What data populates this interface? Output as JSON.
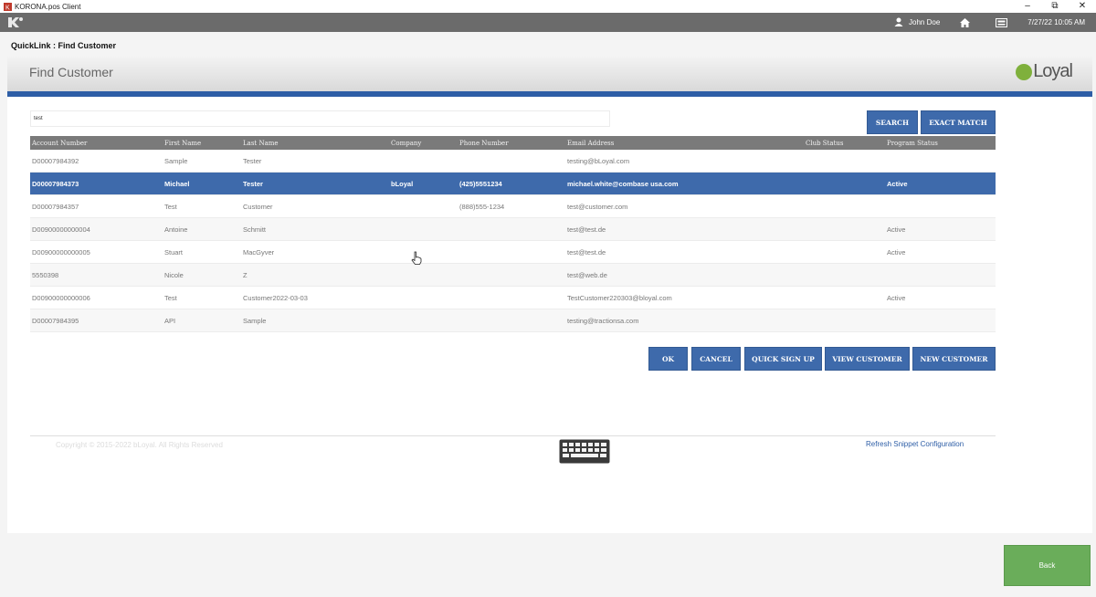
{
  "window": {
    "title": "KORONA.pos Client",
    "minimize": "–",
    "restore": "⧉",
    "close": "✕"
  },
  "header": {
    "user": "John Doe",
    "datetime": "7/27/22 10:05 AM"
  },
  "breadcrumb": "QuickLink : Find Customer",
  "page": {
    "title": "Find Customer",
    "brand": "Loyal"
  },
  "search": {
    "value": "test",
    "placeholder": ""
  },
  "buttons": {
    "search": "SEARCH",
    "exact_match": "EXACT MATCH",
    "ok": "OK",
    "cancel": "CANCEL",
    "quick_sign_up": "QUICK SIGN UP",
    "view_customer": "VIEW CUSTOMER",
    "new_customer": "NEW CUSTOMER",
    "back": "Back"
  },
  "table": {
    "columns": [
      "Account Number",
      "First Name",
      "Last Name",
      "Company",
      "Phone Number",
      "Email Address",
      "Club Status",
      "Program Status"
    ],
    "rows": [
      [
        "D00007984392",
        "Sample",
        "Tester",
        "",
        "",
        "testing@bLoyal.com",
        "",
        ""
      ],
      [
        "D00007984373",
        "Michael",
        "Tester",
        "bLoyal",
        "(425)5551234",
        "michael.white@combase usa.com",
        "",
        "Active"
      ],
      [
        "D00007984357",
        "Test",
        "Customer",
        "",
        "(888)555-1234",
        "test@customer.com",
        "",
        ""
      ],
      [
        "D00900000000004",
        "Antoine",
        "Schmitt",
        "",
        "",
        "test@test.de",
        "",
        "Active"
      ],
      [
        "D00900000000005",
        "Stuart",
        "MacGyver",
        "",
        "",
        "test@test.de",
        "",
        "Active"
      ],
      [
        "5550398",
        "Nicole",
        "Z",
        "",
        "",
        "test@web.de",
        "",
        ""
      ],
      [
        "D00900000000006",
        "Test",
        "Customer2022-03-03",
        "",
        "",
        "TestCustomer220303@bloyal.com",
        "",
        "Active"
      ],
      [
        "D00007984395",
        "API",
        "Sample",
        "",
        "",
        "testing@tractionsa.com",
        "",
        ""
      ]
    ],
    "selected_row": 1
  },
  "footer": {
    "copyright": "Copyright © 2015-2022 bLoyal. All Rights Reserved",
    "refresh": "Refresh Snippet Configuration"
  },
  "colors": {
    "accent": "#3e6aab",
    "back": "#6aad5a",
    "brand_green": "#7fb03c",
    "header": "#6b6b6b"
  }
}
